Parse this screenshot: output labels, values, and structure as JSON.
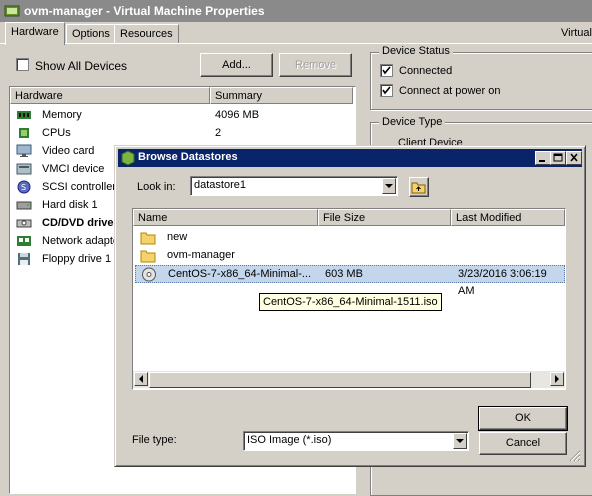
{
  "window": {
    "title": "ovm-manager - Virtual Machine Properties",
    "right_label": "Virtual"
  },
  "tabs": [
    {
      "label": "Hardware",
      "active": true
    },
    {
      "label": "Options",
      "active": false
    },
    {
      "label": "Resources",
      "active": false
    }
  ],
  "show_all_devices": {
    "label": "Show All Devices",
    "checked": false
  },
  "buttons": {
    "add": "Add...",
    "remove": "Remove"
  },
  "hardware_table": {
    "columns": [
      "Hardware",
      "Summary"
    ],
    "rows": [
      {
        "name": "Memory",
        "summary": "4096 MB",
        "icon": "memory-icon"
      },
      {
        "name": "CPUs",
        "summary": "2",
        "icon": "cpu-icon"
      },
      {
        "name": "Video card",
        "summary": "",
        "icon": "monitor-icon"
      },
      {
        "name": "VMCI device",
        "summary": "",
        "icon": "vmci-icon"
      },
      {
        "name": "SCSI controller",
        "summary": "",
        "icon": "scsi-icon"
      },
      {
        "name": "Hard disk 1",
        "summary": "",
        "icon": "disk-icon"
      },
      {
        "name": "CD/DVD drive",
        "summary": "",
        "icon": "cdrom-icon",
        "selected": true
      },
      {
        "name": "Network adapter",
        "summary": "",
        "icon": "network-icon"
      },
      {
        "name": "Floppy drive 1",
        "summary": "",
        "icon": "floppy-icon"
      }
    ]
  },
  "device_status": {
    "title": "Device Status",
    "connected": {
      "label": "Connected",
      "checked": true
    },
    "connect_power_on": {
      "label": "Connect at power on",
      "checked": true
    }
  },
  "device_type": {
    "title": "Device Type",
    "client_device": "Client Device"
  },
  "dialog": {
    "title": "Browse Datastores",
    "look_in_label": "Look in:",
    "look_in_value": "datastore1",
    "columns": [
      "Name",
      "File Size",
      "Last Modified"
    ],
    "files": [
      {
        "name": "new",
        "size": "",
        "modified": "",
        "icon": "folder-icon"
      },
      {
        "name": "ovm-manager",
        "size": "",
        "modified": "",
        "icon": "folder-icon"
      },
      {
        "name": "CentOS-7-x86_64-Minimal-...",
        "size": "603 MB",
        "modified": "3/23/2016 3:06:19 AM",
        "icon": "iso-disc-icon",
        "selected": true
      }
    ],
    "tooltip": "CentOS-7-x86_64-Minimal-1511.iso",
    "file_type_label": "File type:",
    "file_type_value": "ISO Image (*.iso)",
    "ok": "OK",
    "cancel": "Cancel"
  }
}
